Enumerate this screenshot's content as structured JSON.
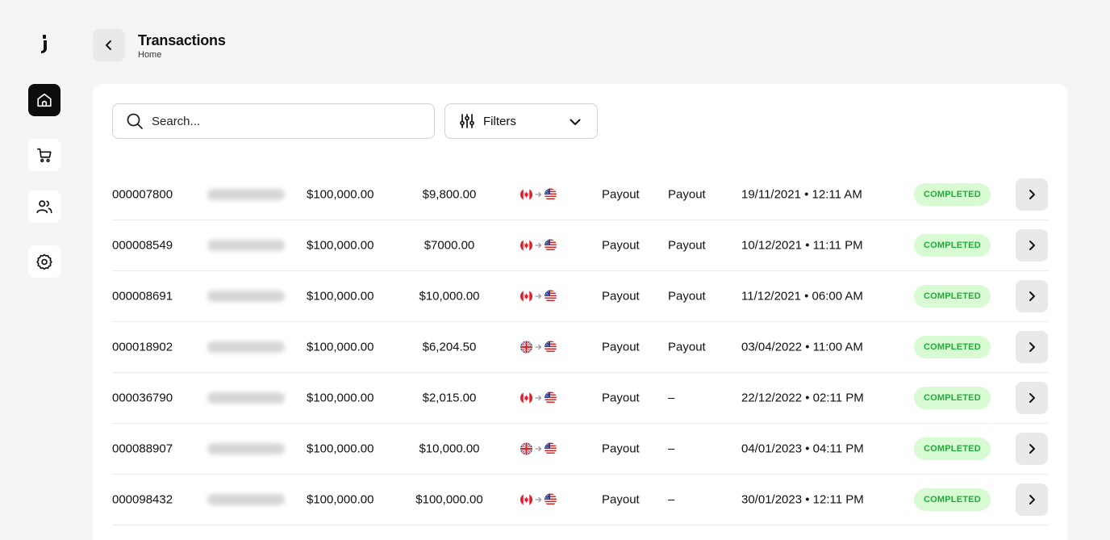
{
  "header": {
    "title": "Transactions",
    "breadcrumb": "Home"
  },
  "search": {
    "placeholder": "Search..."
  },
  "filters": {
    "label": "Filters"
  },
  "sidebar": {
    "items": [
      {
        "name": "home",
        "icon": "home-icon",
        "active": true
      },
      {
        "name": "cart",
        "icon": "cart-icon",
        "active": false
      },
      {
        "name": "users",
        "icon": "users-icon",
        "active": false
      },
      {
        "name": "settings",
        "icon": "gear-icon",
        "active": false
      }
    ]
  },
  "colors": {
    "status_bg": "#d9fbd3",
    "status_text": "#1fad3a",
    "active_nav": "#0d0d0d"
  },
  "transactions": [
    {
      "id": "000007800",
      "amount": "$100,000.00",
      "received": "$9,800.00",
      "from_flag": "ca",
      "to_flag": "us",
      "type": "Payout",
      "method": "Payout",
      "date": "19/11/2021 • 12:11 AM",
      "status": "COMPLETED"
    },
    {
      "id": "000008549",
      "amount": "$100,000.00",
      "received": "$7000.00",
      "from_flag": "ca",
      "to_flag": "us",
      "type": "Payout",
      "method": "Payout",
      "date": "10/12/2021 • 11:11 PM",
      "status": "COMPLETED"
    },
    {
      "id": "000008691",
      "amount": "$100,000.00",
      "received": "$10,000.00",
      "from_flag": "ca",
      "to_flag": "us",
      "type": "Payout",
      "method": "Payout",
      "date": "11/12/2021 • 06:00 AM",
      "status": "COMPLETED"
    },
    {
      "id": "000018902",
      "amount": "$100,000.00",
      "received": "$6,204.50",
      "from_flag": "gb",
      "to_flag": "us",
      "type": "Payout",
      "method": "Payout",
      "date": "03/04/2022 • 11:00 AM",
      "status": "COMPLETED"
    },
    {
      "id": "000036790",
      "amount": "$100,000.00",
      "received": "$2,015.00",
      "from_flag": "ca",
      "to_flag": "us",
      "type": "Payout",
      "method": "–",
      "date": "22/12/2022 • 02:11 PM",
      "status": "COMPLETED"
    },
    {
      "id": "000088907",
      "amount": "$100,000.00",
      "received": "$10,000.00",
      "from_flag": "gb",
      "to_flag": "us",
      "type": "Payout",
      "method": "–",
      "date": "04/01/2023 • 04:11 PM",
      "status": "COMPLETED"
    },
    {
      "id": "000098432",
      "amount": "$100,000.00",
      "received": "$100,000.00",
      "from_flag": "ca",
      "to_flag": "us",
      "type": "Payout",
      "method": "–",
      "date": "30/01/2023 • 12:11 PM",
      "status": "COMPLETED"
    }
  ]
}
